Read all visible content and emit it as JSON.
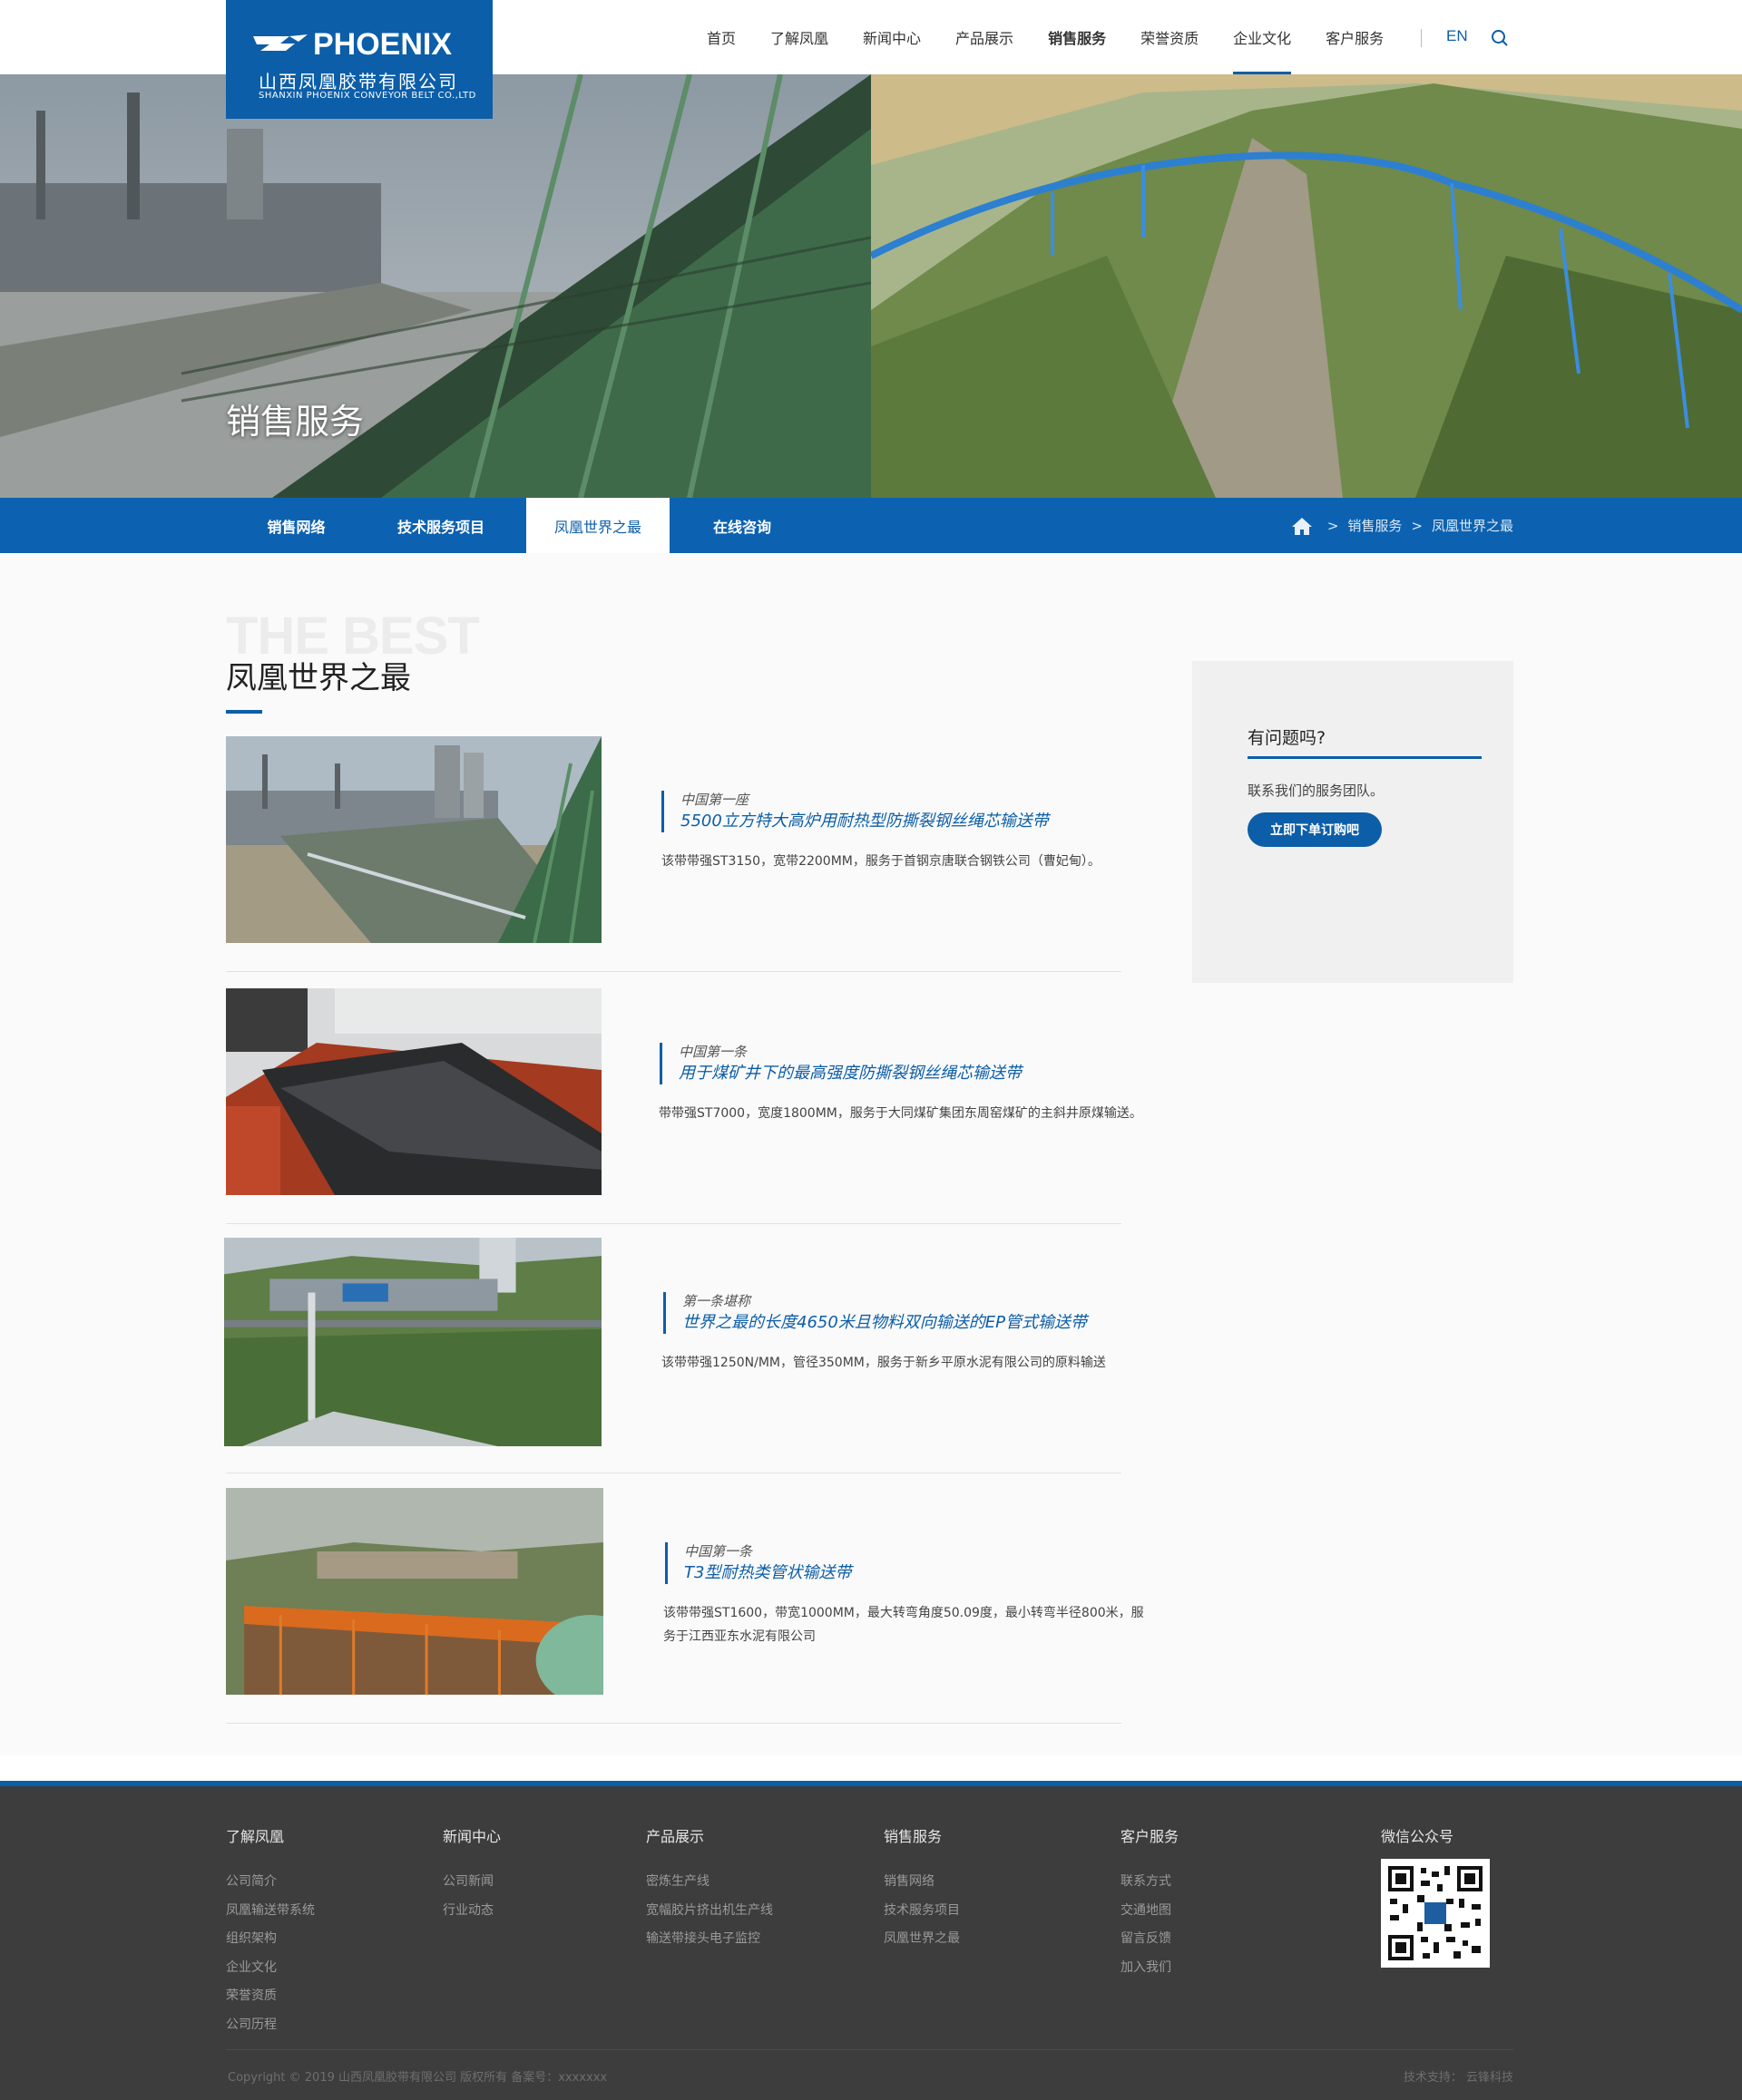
{
  "header": {
    "logo": {
      "brand": "PHOENIX",
      "cn": "山西凤凰胶带有限公司",
      "en": "SHANXIN PHOENIX CONVEYOR BELT CO.,LTD"
    },
    "nav": [
      "首页",
      "了解凤凰",
      "新闻中心",
      "产品展示",
      "销售服务",
      "荣誉资质",
      "企业文化",
      "客户服务"
    ],
    "lang": "EN"
  },
  "banner": {
    "title": "销售服务"
  },
  "subnav": {
    "tabs": [
      "销售网络",
      "技术服务项目",
      "凤凰世界之最",
      "在线咨询"
    ],
    "active_tab": "凤凰世界之最",
    "breadcrumb": [
      "销售服务",
      "凤凰世界之最"
    ]
  },
  "section": {
    "ghost": "THE BEST",
    "title": "凤凰世界之最"
  },
  "items": [
    {
      "tag": "中国第一座",
      "title": "5500立方特大高炉用耐热型防撕裂钢丝绳芯输送带",
      "desc": "该带带强ST3150，宽带2200MM，服务于首钢京唐联合钢铁公司（曹妃甸）。"
    },
    {
      "tag": "中国第一条",
      "title": "用于煤矿井下的最高强度防撕裂钢丝绳芯输送带",
      "desc": "带带强ST7000，宽度1800MM，服务于大同煤矿集团东周窑煤矿的主斜井原煤输送。"
    },
    {
      "tag": "第一条堪称",
      "title": "世界之最的长度4650米且物料双向输送的EP管式输送带",
      "desc": "该带带强1250N/MM，管径350MM，服务于新乡平原水泥有限公司的原料输送"
    },
    {
      "tag": "中国第一条",
      "title": "T3型耐热类管状输送带",
      "desc": "该带带强ST1600，带宽1000MM，最大转弯角度50.09度，最小转弯半径800米，服务于江西亚东水泥有限公司"
    }
  ],
  "help": {
    "title": "有问题吗?",
    "text": "联系我们的服务团队。",
    "button": "立即下单订购吧"
  },
  "footer": {
    "columns": [
      {
        "heading": "了解凤凰",
        "links": [
          "公司简介",
          "凤凰输送带系统",
          "组织架构",
          "企业文化",
          "荣誉资质",
          "公司历程"
        ]
      },
      {
        "heading": "新闻中心",
        "links": [
          "公司新闻",
          "行业动态"
        ]
      },
      {
        "heading": "产品展示",
        "links": [
          "密炼生产线",
          "宽幅胶片挤出机生产线",
          "输送带接头电子监控"
        ]
      },
      {
        "heading": "销售服务",
        "links": [
          "销售网络",
          "技术服务项目",
          "凤凰世界之最"
        ]
      },
      {
        "heading": "客户服务",
        "links": [
          "联系方式",
          "交通地图",
          "留言反馈",
          "加入我们"
        ]
      }
    ],
    "wechat": "微信公众号",
    "copyright": "Copyright © 2019 山西凤凰胶带有限公司  版权所有   备案号：xxxxxxx",
    "tech_support": "技术支持：  云锋科技"
  },
  "colors": {
    "brand_blue": "#0c5ea8",
    "footer_bg": "#3d3d3d"
  }
}
